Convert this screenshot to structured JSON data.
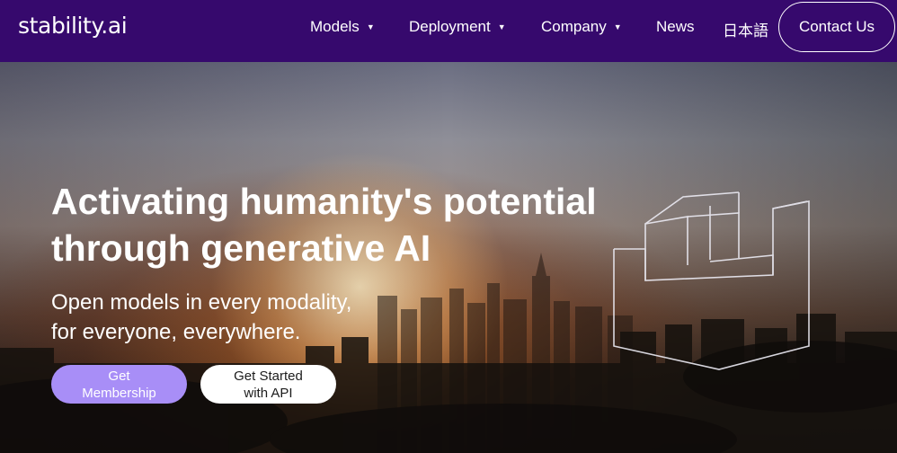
{
  "brand": {
    "logo_text": "stability.ai"
  },
  "nav": {
    "items": [
      {
        "label": "Models",
        "has_dropdown": true,
        "dropdown_glyph": "▼"
      },
      {
        "label": "Deployment",
        "has_dropdown": true,
        "dropdown_glyph": "▼"
      },
      {
        "label": "Company",
        "has_dropdown": true,
        "dropdown_glyph": "▼"
      },
      {
        "label": "News",
        "has_dropdown": false
      },
      {
        "label": "日本語",
        "has_dropdown": false
      }
    ],
    "contact_label": "Contact Us"
  },
  "hero": {
    "headline_line1": "Activating humanity's potential",
    "headline_line2": "through generative AI",
    "subline_line1": "Open models in every modality,",
    "subline_line2": "for everyone, everywhere.",
    "primary_button_line1": "Get",
    "primary_button_line2": "Membership",
    "secondary_button_line1": "Get Started",
    "secondary_button_line2": "with API"
  },
  "colors": {
    "nav_background": "#36096d",
    "primary_button": "#a88ef7",
    "secondary_button": "#ffffff",
    "text_light": "#ffffff"
  },
  "icons": {
    "dropdown": "chevron-down-icon",
    "outline_shape": "isometric-outline-graphic"
  }
}
